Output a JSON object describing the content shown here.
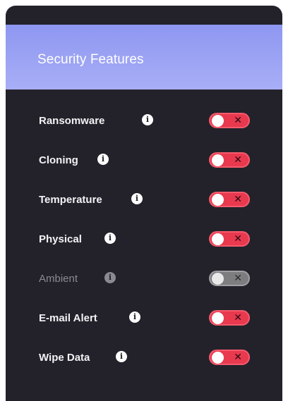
{
  "panel": {
    "title": "Security Features"
  },
  "features": [
    {
      "label": "Ransomware",
      "enabled": false,
      "disabled": false,
      "toggle_symbol": "✕"
    },
    {
      "label": "Cloning",
      "enabled": false,
      "disabled": false,
      "toggle_symbol": "✕"
    },
    {
      "label": "Temperature",
      "enabled": false,
      "disabled": false,
      "toggle_symbol": "✕"
    },
    {
      "label": "Physical",
      "enabled": false,
      "disabled": false,
      "toggle_symbol": "✕"
    },
    {
      "label": "Ambient",
      "enabled": false,
      "disabled": true,
      "toggle_symbol": "✕"
    },
    {
      "label": "E-mail Alert",
      "enabled": false,
      "disabled": false,
      "toggle_symbol": "✕"
    },
    {
      "label": "Wipe Data",
      "enabled": false,
      "disabled": false,
      "toggle_symbol": "✕"
    }
  ],
  "info_icon_glyph": "i",
  "colors": {
    "panel_bg": "#23222b",
    "header_bg": "#99a0f3",
    "toggle_off": "#e8394f",
    "toggle_disabled": "#7d7d80",
    "text": "#f2f2f4",
    "text_disabled": "#8a8a90"
  }
}
